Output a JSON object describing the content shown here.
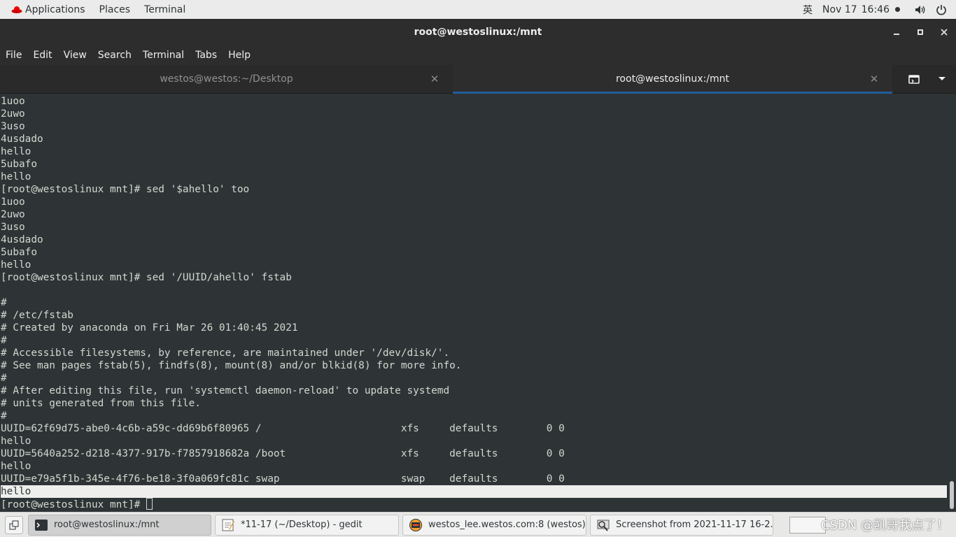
{
  "topbar": {
    "applications": "Applications",
    "places": "Places",
    "terminal": "Terminal",
    "ime": "英",
    "date": "Nov 17",
    "time": "16:46",
    "icons": [
      "redhat-logo-icon",
      "volume-icon",
      "power-icon"
    ]
  },
  "window": {
    "title": "root@westoslinux:/mnt"
  },
  "menubar": {
    "file": "File",
    "edit": "Edit",
    "view": "View",
    "search": "Search",
    "terminal": "Terminal",
    "tabs": "Tabs",
    "help": "Help"
  },
  "tabs": [
    {
      "label": "westos@westos:~/Desktop",
      "active": false
    },
    {
      "label": "root@westoslinux:/mnt",
      "active": true
    }
  ],
  "terminal": {
    "lines": [
      "1uoo",
      "2uwo",
      "3uso",
      "4usdado",
      "hello",
      "5ubafo",
      "hello",
      "[root@westoslinux mnt]# sed '$ahello' too",
      "1uoo",
      "2uwo",
      "3uso",
      "4usdado",
      "5ubafo",
      "hello",
      "[root@westoslinux mnt]# sed '/UUID/ahello' fstab",
      "",
      "#",
      "# /etc/fstab",
      "# Created by anaconda on Fri Mar 26 01:40:45 2021",
      "#",
      "# Accessible filesystems, by reference, are maintained under '/dev/disk/'.",
      "# See man pages fstab(5), findfs(8), mount(8) and/or blkid(8) for more info.",
      "#",
      "# After editing this file, run 'systemctl daemon-reload' to update systemd",
      "# units generated from this file.",
      "#",
      "UUID=62f69d75-abe0-4c6b-a59c-dd69b6f80965 /                       xfs     defaults        0 0",
      "hello",
      "UUID=5640a252-d218-4377-917b-f7857918682a /boot                   xfs     defaults        0 0",
      "hello",
      "UUID=e79a5f1b-345e-4f76-be18-3f0a069fc81c swap                    swap    defaults        0 0",
      "hello"
    ],
    "prompt": "[root@westoslinux mnt]# "
  },
  "taskbar": {
    "tasks": [
      {
        "label": "root@westoslinux:/mnt",
        "icon": "terminal-icon",
        "active": true
      },
      {
        "label": "*11-17 (~/Desktop) - gedit",
        "icon": "gedit-icon",
        "active": false
      },
      {
        "label": "westos_lee.westos.com:8 (westos) ...",
        "icon": "vnc-viewer-icon",
        "active": false
      },
      {
        "label": "Screenshot from 2021-11-17 16-2...",
        "icon": "screenshot-icon",
        "active": false
      }
    ],
    "watermark": "CSDN @凯哥我点了！"
  }
}
